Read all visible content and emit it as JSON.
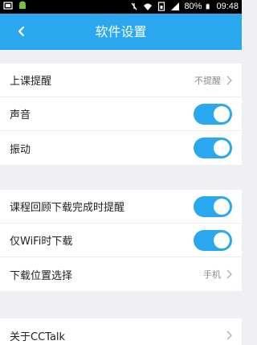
{
  "status_bar": {
    "battery_percent": "80%",
    "time": "09:48",
    "icons": [
      "notification-icon",
      "android-icon",
      "mute-icon",
      "wifi-icon",
      "sim-icon",
      "signal-icon",
      "battery-icon"
    ]
  },
  "header": {
    "title": "软件设置",
    "back_icon": "back-arrow-icon"
  },
  "section1": {
    "items": [
      {
        "label": "上课提醒",
        "value": "不提醒",
        "type": "link"
      },
      {
        "label": "声音",
        "type": "toggle",
        "on": true
      },
      {
        "label": "振动",
        "type": "toggle",
        "on": true
      }
    ]
  },
  "section2": {
    "items": [
      {
        "label": "课程回顾下载完成时提醒",
        "type": "toggle",
        "on": true
      },
      {
        "label": "仅WiFi时下载",
        "type": "toggle",
        "on": true
      },
      {
        "label": "下载位置选择",
        "value": "手机",
        "type": "link"
      }
    ]
  },
  "section3": {
    "items": [
      {
        "label": "关于CCTalk",
        "type": "link"
      }
    ]
  },
  "colors": {
    "accent": "#29a8f0",
    "background": "#efeff4"
  }
}
